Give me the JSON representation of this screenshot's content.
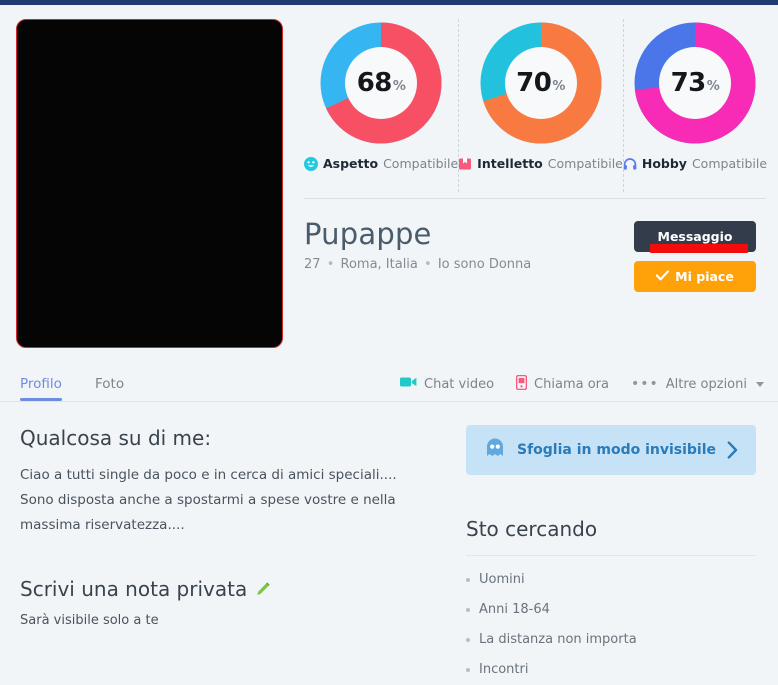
{
  "topbar_color": "#1f3c72",
  "photo": {
    "name": "profile-photo",
    "border_color": "#d8252a",
    "background": "#050505"
  },
  "stats": [
    {
      "value": 68,
      "percent_symbol": "%",
      "label_bold": "Aspetto",
      "label_rest": "Compatibile",
      "icon": "smiley-icon",
      "fill_color": "#f75065",
      "track_color": "#35b5f2"
    },
    {
      "value": 70,
      "percent_symbol": "%",
      "label_bold": "Intelletto",
      "label_rest": "Compatibile",
      "icon": "book-icon",
      "fill_color": "#f97a41",
      "track_color": "#22c1dd"
    },
    {
      "value": 73,
      "percent_symbol": "%",
      "label_bold": "Hobby",
      "label_rest": "Compatibile",
      "icon": "headphones-icon",
      "fill_color": "#f72bb6",
      "track_color": "#4a76ea"
    }
  ],
  "identity": {
    "name": "Pupappe",
    "age": "27",
    "location": "Roma, Italia",
    "gender": "Io sono Donna",
    "separator": "•"
  },
  "actions": {
    "message_label": "Messaggio",
    "like_label": "Mi piace",
    "like_icon": "check-icon",
    "highlight_color": "#f40b0b"
  },
  "tabs": [
    {
      "label": "Profilo",
      "active": true
    },
    {
      "label": "Foto",
      "active": false
    }
  ],
  "tools": [
    {
      "label": "Chat video",
      "icon": "video-camera-icon",
      "color": "#22c9c9"
    },
    {
      "label": "Chiama ora",
      "icon": "mobile-phone-icon",
      "color": "#f75a7c"
    },
    {
      "label": "Altre opzioni",
      "icon": "ellipsis-icon",
      "has_caret": true
    }
  ],
  "about": {
    "heading": "Qualcosa su di me:",
    "text": "Ciao a tutti single da poco e in cerca di amici speciali.... Sono disposta anche a spostarmi a spese vostre e nella massima riservatezza...."
  },
  "private_note": {
    "heading": "Scrivi una nota privata",
    "edit_icon": "pencil-icon",
    "subtext": "Sarà visibile solo a te"
  },
  "invisible_banner": {
    "label": "Sfoglia in modo invisibile",
    "icon": "ghost-icon",
    "chevron": "chevron-right-icon",
    "background": "#c6e2f7",
    "text_color": "#2b7bb9"
  },
  "seeking": {
    "heading": "Sto cercando",
    "items": [
      "Uomini",
      "Anni 18-64",
      "La distanza non importa",
      "Incontri"
    ]
  }
}
